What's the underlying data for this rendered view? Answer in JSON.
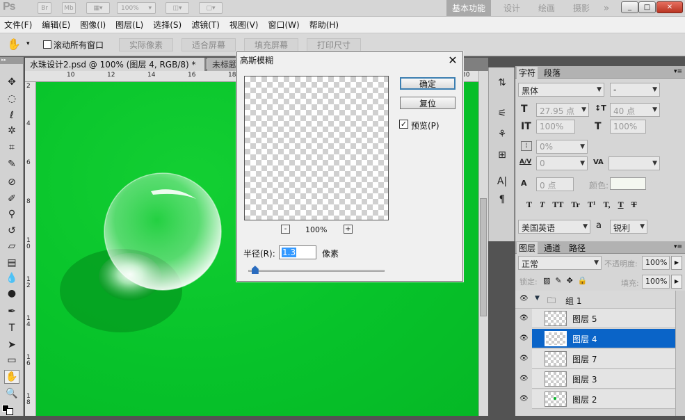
{
  "app": {
    "logo": "Ps",
    "br": "Br",
    "mb": "Mb",
    "zoom": "100%",
    "arrow": "»"
  },
  "workspaces": [
    "基本功能",
    "设计",
    "绘画",
    "摄影"
  ],
  "window": {
    "minimize": "_",
    "maximize": "□",
    "close": "✕"
  },
  "menu": [
    "文件(F)",
    "编辑(E)",
    "图像(I)",
    "图层(L)",
    "选择(S)",
    "滤镜(T)",
    "视图(V)",
    "窗口(W)",
    "帮助(H)"
  ],
  "options": {
    "scroll_all": "滚动所有窗口",
    "actual_pixels": "实际像素",
    "fit_screen": "适合屏幕",
    "fill_screen": "填充屏幕",
    "print_size": "打印尺寸"
  },
  "tabs": {
    "doc1": "水珠设计2.psd @ 100% (图层 4, RGB/8) *",
    "doc1_close": "✕",
    "doc2": "未标题"
  },
  "ruler": {
    "top": [
      "10",
      "12",
      "14",
      "16",
      "18",
      "30"
    ],
    "left": [
      "2",
      "4",
      "6",
      "8",
      "1 0",
      "1 2",
      "1 4",
      "1 6",
      "1 8"
    ]
  },
  "dialog": {
    "title": "高斯模糊",
    "close": "✕",
    "ok": "确定",
    "reset": "复位",
    "preview_label": "预览(P)",
    "preview_checked": "✓",
    "zoom_out": "-",
    "zoom_in": "+",
    "zoom": "100%",
    "radius_label": "半径(R):",
    "radius_value": "1.3",
    "radius_unit": "像素",
    "radius_slider": 0.05
  },
  "char_panel": {
    "tab1": "字符",
    "tab2": "段落",
    "font": "黑体",
    "style": "-",
    "size": "27.95 点",
    "leading": "40 点",
    "vscale": "100%",
    "hscale": "100%",
    "tsume": "0%",
    "tracking": "0",
    "kerning": "",
    "baseline": "0 点",
    "color_label": "颜色:",
    "language": "美国英语",
    "aa_label": "a",
    "aa": "锐利",
    "styles": [
      "T",
      "T",
      "TT",
      "Tr",
      "T¹",
      "T,",
      "T",
      "T"
    ],
    "icons": [
      "T",
      "↕T",
      "IT",
      "T",
      "A/V",
      "VA",
      "A"
    ]
  },
  "layer_panel": {
    "tab1": "图层",
    "tab2": "通道",
    "tab3": "路径",
    "blend": "正常",
    "opacity_label": "不透明度:",
    "opacity": "100%",
    "lock_label": "锁定:",
    "fill_label": "填充:",
    "fill": "100%",
    "group": "组 1",
    "layers": [
      "图层 5",
      "图层 4",
      "图层 7",
      "图层 3",
      "图层 2"
    ],
    "selected_index": 1,
    "eye": "👁"
  },
  "colors": {
    "canvas": "#07c32a",
    "selection": "#0a64c8",
    "accent": "#3399ff"
  }
}
